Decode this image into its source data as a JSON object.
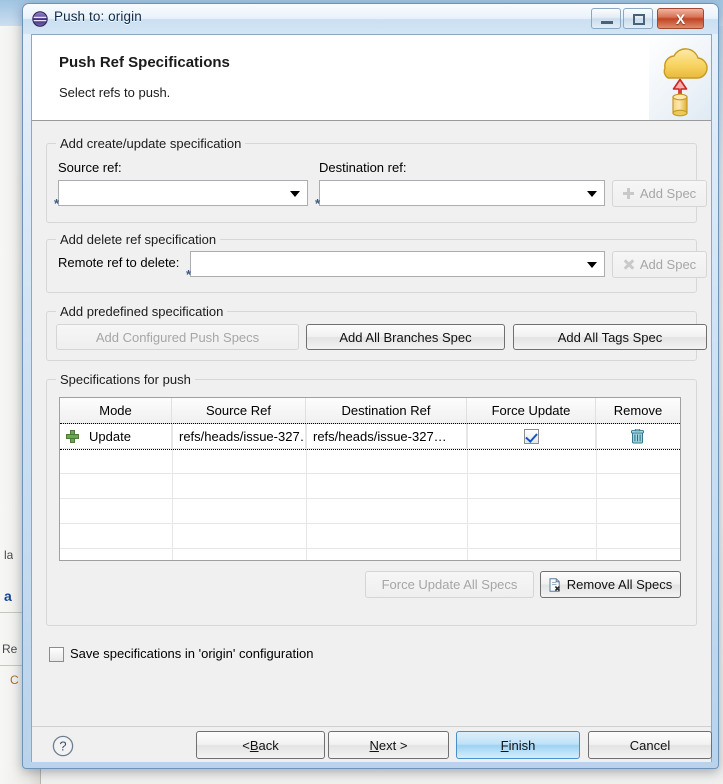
{
  "window": {
    "title": "Push to: origin",
    "icon": "eclipse-sphere-icon",
    "controls": {
      "minimize": "–",
      "maximize": "□",
      "close": "X"
    }
  },
  "wizard": {
    "title": "Push Ref Specifications",
    "subtitle": "Select refs to push.",
    "banner_icon": "push-to-cloud-icon"
  },
  "create_update_group": {
    "legend": "Add create/update specification",
    "source_ref": {
      "label": "Source ref:",
      "value": "",
      "required_marker": "*"
    },
    "destination_ref": {
      "label": "Destination ref:",
      "value": "",
      "required_marker": "*"
    },
    "add_spec_button": {
      "label": "Add Spec",
      "icon": "plus-icon",
      "enabled": false
    }
  },
  "delete_group": {
    "legend": "Add delete ref specification",
    "remote_ref": {
      "label": "Remote ref to delete:",
      "value": "",
      "required_marker": "*"
    },
    "add_spec_button": {
      "label": "Add Spec",
      "icon": "x-icon",
      "enabled": false
    }
  },
  "predefined_group": {
    "legend": "Add predefined specification",
    "buttons": [
      {
        "label": "Add Configured Push Specs",
        "enabled": false
      },
      {
        "label": "Add All Branches Spec",
        "enabled": true
      },
      {
        "label": "Add All Tags Spec",
        "enabled": true
      }
    ]
  },
  "specs_group": {
    "legend": "Specifications for push",
    "table": {
      "columns": [
        "Mode",
        "Source Ref",
        "Destination Ref",
        "Force Update",
        "Remove"
      ],
      "rows": [
        {
          "mode_icon": "green-plus-icon",
          "mode": "Update",
          "source_ref": "refs/heads/issue-327…",
          "destination_ref": "refs/heads/issue-327…",
          "force_update": true,
          "remove_icon": "trash-icon",
          "selected": true
        }
      ],
      "empty_rows": 5
    },
    "force_update_all_button": {
      "label": "Force Update All Specs",
      "enabled": false
    },
    "remove_all_button": {
      "label": "Remove All Specs",
      "icon": "remove-doc-icon",
      "enabled": true
    }
  },
  "save_option": {
    "label": "Save specifications in 'origin' configuration",
    "checked": false
  },
  "footer": {
    "help_icon": "help-question-icon",
    "buttons": [
      {
        "name": "back",
        "prefix": "< ",
        "mnemonic": "B",
        "suffix": "ack",
        "enabled": true,
        "default": false
      },
      {
        "name": "next",
        "prefix": "",
        "mnemonic": "N",
        "suffix": "ext >",
        "enabled": true,
        "default": false
      },
      {
        "name": "finish",
        "prefix": "",
        "mnemonic": "F",
        "suffix": "inish",
        "enabled": true,
        "default": true
      },
      {
        "name": "cancel",
        "prefix": "",
        "mnemonic": "",
        "suffix": "Cancel",
        "enabled": true,
        "default": false
      }
    ]
  },
  "background": {
    "fragments": [
      "la",
      "a",
      "Re",
      "C"
    ]
  },
  "colors": {
    "accent": "#1557c0",
    "dialog_bg": "#f0f0f0",
    "banner_bg": "#ffffff",
    "close_button": "#c04524",
    "green_plus": "#6aa84f",
    "trash": "#3f8fa5"
  }
}
